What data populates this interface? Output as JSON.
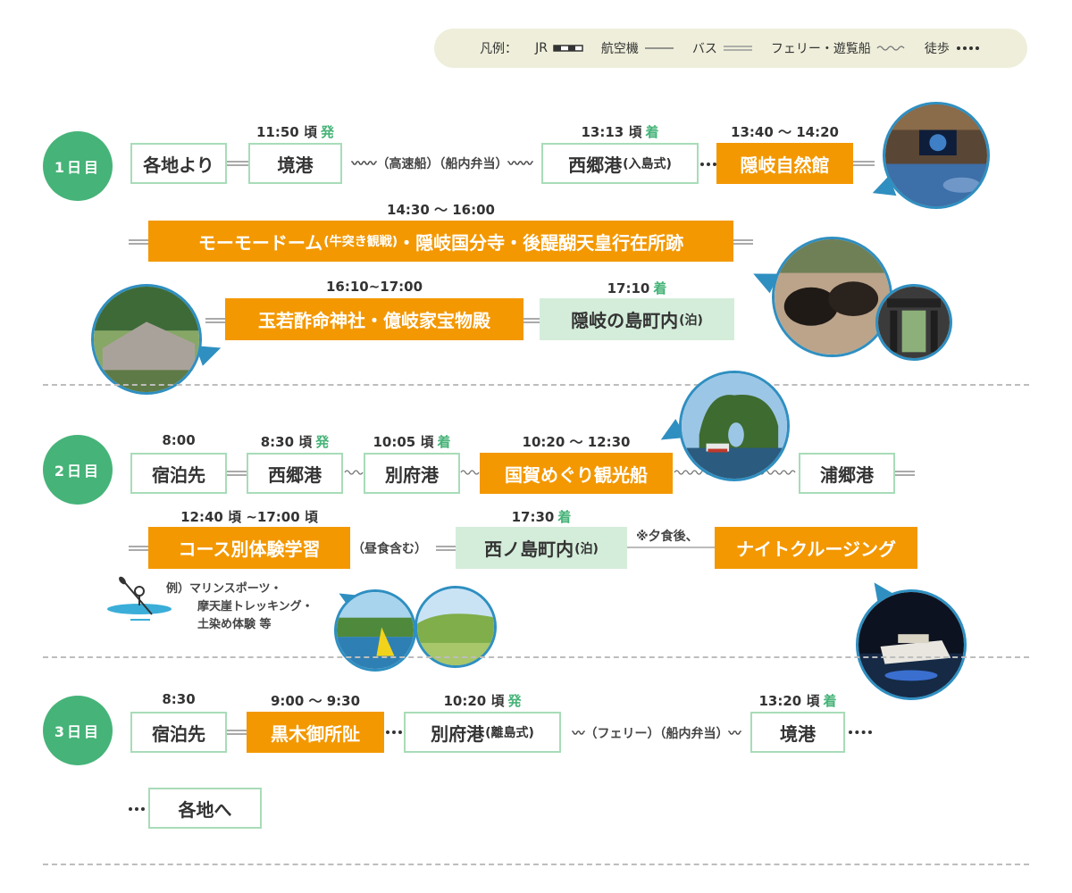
{
  "legend": {
    "label": "凡例：",
    "items": [
      {
        "label": "JR",
        "icon": "jr-line-icon"
      },
      {
        "label": "航空機",
        "icon": "plane-line-icon"
      },
      {
        "label": "バス",
        "icon": "bus-line-icon"
      },
      {
        "label": "フェリー・遊覧船",
        "icon": "ferry-wave-icon"
      },
      {
        "label": "徒歩",
        "icon": "walk-dots-icon"
      }
    ]
  },
  "colors": {
    "green": "#46b378",
    "orange": "#f39800",
    "mint": "#d4edda",
    "photo_border": "#2f8fc1"
  },
  "day1": {
    "badge": "1日目",
    "start": "各地より",
    "port1": {
      "name": "境港",
      "time": "11:50 頃",
      "mark": "発"
    },
    "ferry_note": "〰〰（高速船）（船内弁当）〰〰",
    "port2": {
      "name": "西郷港",
      "sub": "(入島式)",
      "time": "13:13 頃",
      "mark": "着"
    },
    "museum": {
      "name": "隠岐自然館",
      "time": "13:40 〜 14:20"
    },
    "tour": {
      "name1": "モーモードーム",
      "sub": "(牛突き観戦)",
      "name2": "・隠岐国分寺・後醍醐天皇行在所跡",
      "time": "14:30 〜 16:00"
    },
    "shrine": {
      "name": "玉若酢命神社・億岐家宝物殿",
      "time": "16:10~17:00"
    },
    "stay": {
      "name": "隠岐の島町内",
      "sub": "(泊)",
      "time": "17:10",
      "mark": "着"
    }
  },
  "day2": {
    "badge": "2日目",
    "lodging": {
      "name": "宿泊先",
      "time": "8:00"
    },
    "port1": {
      "name": "西郷港",
      "time": "8:30 頃",
      "mark": "発"
    },
    "port2": {
      "name": "別府港",
      "time": "10:05 頃",
      "mark": "着"
    },
    "cruise": {
      "name": "国賀めぐり観光船",
      "time": "10:20 〜 12:30"
    },
    "port3": {
      "name": "浦郷港"
    },
    "course": {
      "name": "コース別体験学習",
      "time": "12:40 頃 ~17:00 頃"
    },
    "lunch_note": "（昼食含む）",
    "stay": {
      "name": "西ノ島町内",
      "sub": "(泊)",
      "time": "17:30",
      "mark": "着"
    },
    "after_dinner": "※夕食後、",
    "night": {
      "name": "ナイトクルージング"
    },
    "examples": [
      "例）マリンスポーツ・",
      "摩天崖トレッキング・",
      "土染め体験 等"
    ]
  },
  "day3": {
    "badge": "3日目",
    "lodging": {
      "name": "宿泊先",
      "time": "8:30"
    },
    "ruins": {
      "name": "黒木御所阯",
      "time": "9:00 〜 9:30"
    },
    "port1": {
      "name": "別府港",
      "sub": "(離島式)",
      "time": "10:20 頃",
      "mark": "発"
    },
    "ferry_note": "〰（フェリー）（船内弁当）〰",
    "port2": {
      "name": "境港",
      "time": "13:20 頃",
      "mark": "着"
    },
    "end": "各地へ"
  }
}
